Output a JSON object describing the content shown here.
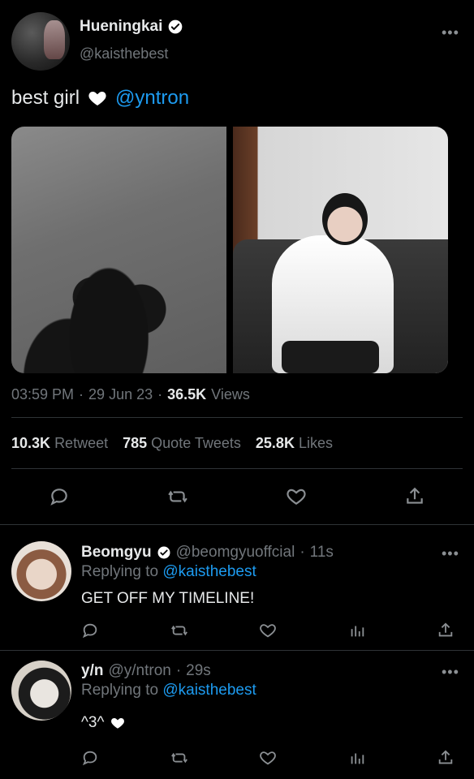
{
  "main_tweet": {
    "display_name": "Hueningkai",
    "handle": "@kaisthebest",
    "text_before": "best girl",
    "mention": "@yntron",
    "time": "03:59 PM",
    "date": "29 Jun 23",
    "views_count": "36.5K",
    "views_label": "Views",
    "retweets_count": "10.3K",
    "retweets_label": "Retweet",
    "quotes_count": "785",
    "quotes_label": "Quote Tweets",
    "likes_count": "25.8K",
    "likes_label": "Likes",
    "more": "•••",
    "separator": "·"
  },
  "replies": [
    {
      "display_name": "Beomgyu",
      "handle": "@beomgyuoffcial",
      "age": "11s",
      "replying_label": "Replying to",
      "replying_to": "@kaisthebest",
      "text": "GET OFF MY TIMELINE!",
      "more": "•••",
      "separator": "·"
    },
    {
      "display_name": "y/n",
      "handle": "@y/ntron",
      "age": "29s",
      "replying_label": "Replying to",
      "replying_to": "@kaisthebest",
      "text": "^3^",
      "more": "•••",
      "separator": "·"
    }
  ],
  "icons": {
    "reply": "reply-icon",
    "retweet": "retweet-icon",
    "like": "heart-icon",
    "share": "share-icon",
    "analytics": "analytics-icon",
    "verified": "verified-badge-icon"
  },
  "colors": {
    "background": "#000000",
    "text": "#e7e9ea",
    "muted": "#71767b",
    "link": "#1d9bf0",
    "divider": "#2f3336"
  }
}
